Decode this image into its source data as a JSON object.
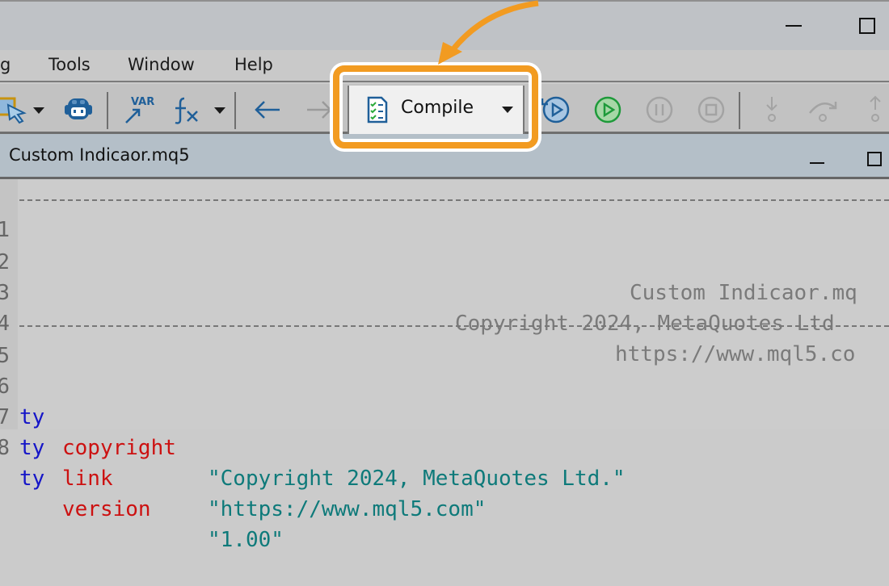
{
  "titlebar": {
    "minimize_icon": "minimize-icon",
    "maximize_icon": "maximize-icon"
  },
  "menubar": {
    "items": [
      {
        "label": "g"
      },
      {
        "label": "Tools"
      },
      {
        "label": "Window"
      },
      {
        "label": "Help"
      }
    ]
  },
  "toolbar": {
    "compile_label": "Compile",
    "icons": [
      "navigator-select-icon",
      "dropdown-icon",
      "robot-icon",
      "var-insert-icon",
      "fx-function-icon",
      "dropdown-icon",
      "back-arrow-icon",
      "forward-arrow-icon",
      "compile-icon",
      "dropdown-icon",
      "restart-debug-icon",
      "start-debug-icon",
      "pause-icon",
      "stop-icon",
      "step-into-icon",
      "step-over-icon",
      "step-out-icon"
    ]
  },
  "document": {
    "tab_title": "Custom Indicaor.mq5"
  },
  "editor": {
    "lines": [
      {
        "number": "1",
        "type": "dashes"
      },
      {
        "number": "2",
        "type": "comment",
        "text": "Custom Indicaor.mq"
      },
      {
        "number": "3",
        "type": "comment",
        "text": "Copyright 2024, MetaQuotes Ltd"
      },
      {
        "number": "4",
        "type": "comment",
        "text": "https://www.mql5.co"
      },
      {
        "number": "5",
        "type": "dashes"
      },
      {
        "number": "6",
        "keyword": "ty",
        "property": "copyright",
        "value": "\"Copyright 2024, MetaQuotes Ltd.\""
      },
      {
        "number": "7",
        "keyword": "ty",
        "property": "link",
        "value": "\"https://www.mql5.com\""
      },
      {
        "number": "8",
        "keyword": "ty",
        "property": "version",
        "value": "\"1.00\""
      }
    ]
  },
  "highlight": {
    "color": "#f29b21",
    "target": "compile-button"
  }
}
